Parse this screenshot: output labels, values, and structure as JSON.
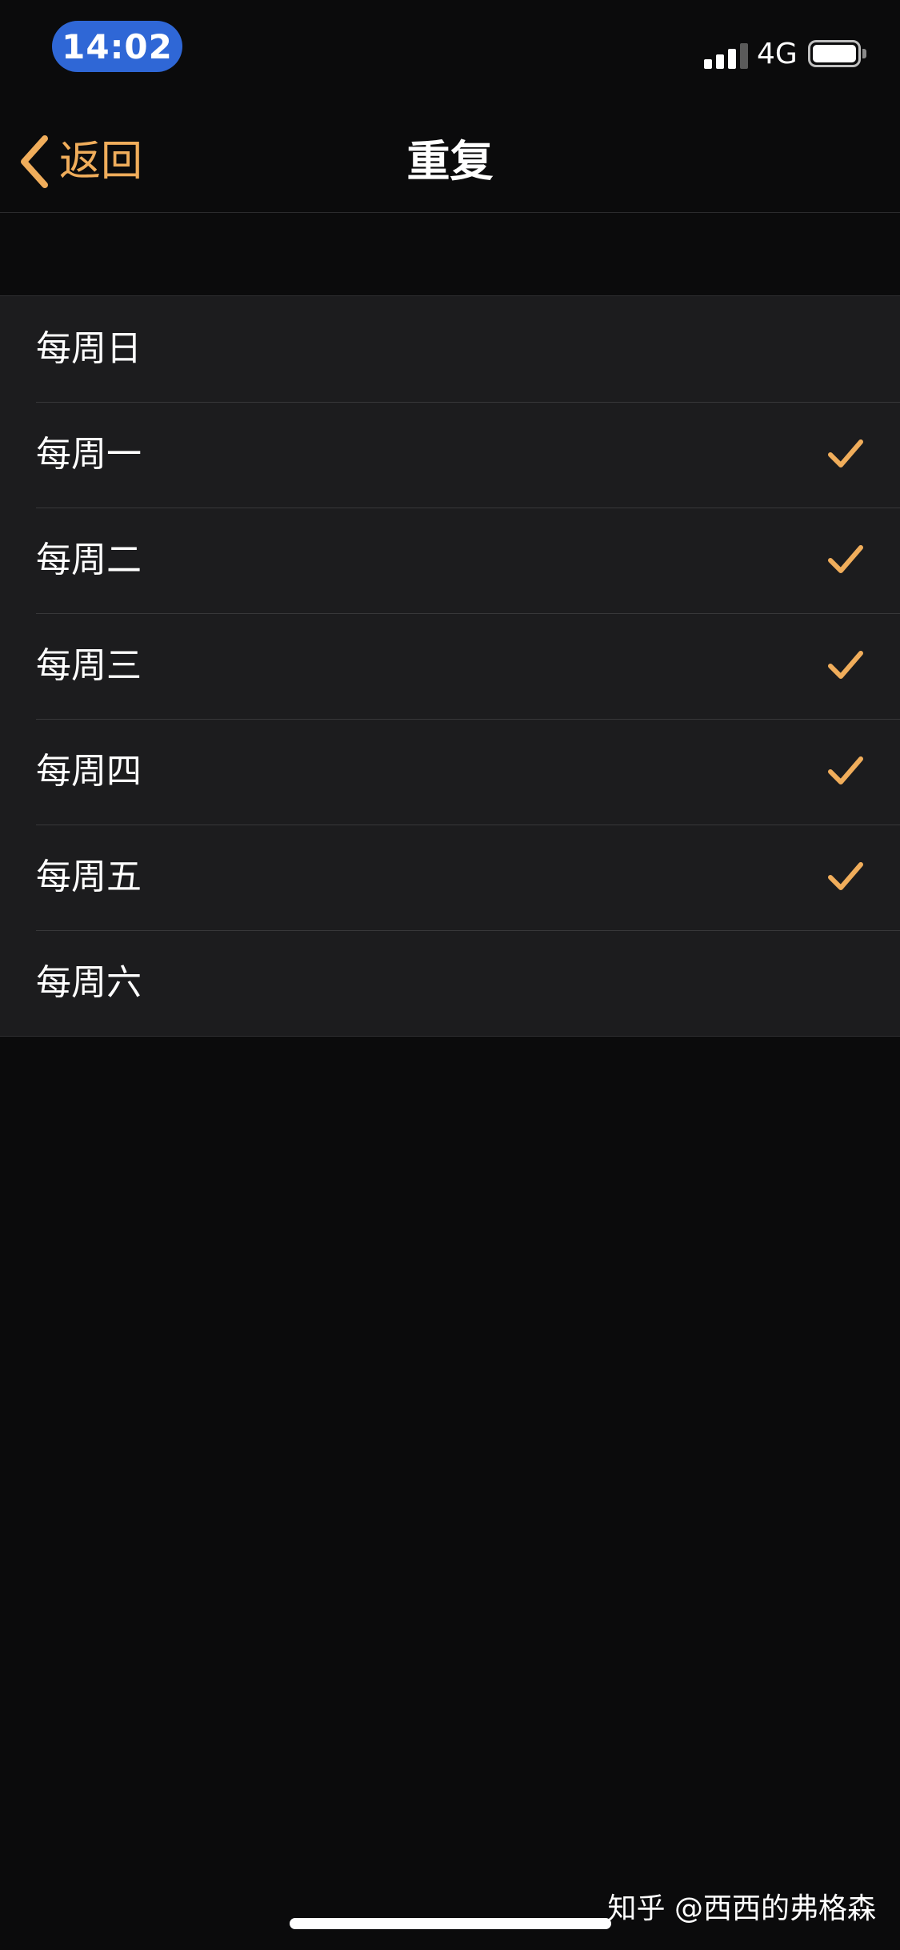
{
  "status_bar": {
    "time": "14:02",
    "network": "4G",
    "icons": [
      "signal-icon",
      "battery-icon"
    ]
  },
  "nav": {
    "back_label": "返回",
    "back_icon": "chevron-left-icon",
    "title": "重复"
  },
  "days": [
    {
      "label": "每周日",
      "checked": false
    },
    {
      "label": "每周一",
      "checked": true
    },
    {
      "label": "每周二",
      "checked": true
    },
    {
      "label": "每周三",
      "checked": true
    },
    {
      "label": "每周四",
      "checked": true
    },
    {
      "label": "每周五",
      "checked": true
    },
    {
      "label": "每周六",
      "checked": false
    }
  ],
  "watermark": "知乎 @西西的弗格森",
  "colors": {
    "accent": "#f0ad5b",
    "background": "#0b0b0c",
    "cell": "#1c1c1e",
    "time_pill": "#2f67d6"
  }
}
